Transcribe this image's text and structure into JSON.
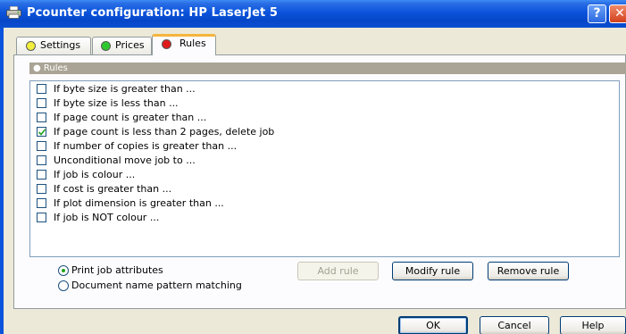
{
  "window": {
    "title": "Pcounter configuration: HP LaserJet 5",
    "help_glyph": "?",
    "close_glyph": "✕",
    "icon": "printer-icon"
  },
  "tabs": [
    {
      "label": "Settings",
      "dot_color": "#f2ee3c",
      "active": false
    },
    {
      "label": "Prices",
      "dot_color": "#2ec92e",
      "active": false
    },
    {
      "label": "Rules",
      "dot_color": "#e01b1b",
      "active": true
    }
  ],
  "group": {
    "title": "● Rules"
  },
  "rules": [
    {
      "label": "If byte size is greater than ...",
      "checked": false
    },
    {
      "label": "If byte size is less than ...",
      "checked": false
    },
    {
      "label": "If page count is greater than ...",
      "checked": false
    },
    {
      "label": "If page count is less than 2 pages, delete job",
      "checked": true
    },
    {
      "label": "If number of copies is greater than ...",
      "checked": false
    },
    {
      "label": "Unconditional move job to ...",
      "checked": false
    },
    {
      "label": "If job is colour ...",
      "checked": false
    },
    {
      "label": "If cost is greater than ...",
      "checked": false
    },
    {
      "label": "If plot dimension is greater than ...",
      "checked": false
    },
    {
      "label": "If job is NOT colour ...",
      "checked": false
    }
  ],
  "display_options": [
    {
      "label": "Print job attributes",
      "selected": true
    },
    {
      "label": "Document name pattern matching",
      "selected": false
    }
  ],
  "rule_buttons": {
    "add": {
      "label": "Add rule",
      "enabled": false
    },
    "modify": {
      "label": "Modify rule",
      "enabled": true
    },
    "remove": {
      "label": "Remove rule",
      "enabled": true
    }
  },
  "dialog_buttons": {
    "ok": "OK",
    "cancel": "Cancel",
    "help": "Help"
  }
}
